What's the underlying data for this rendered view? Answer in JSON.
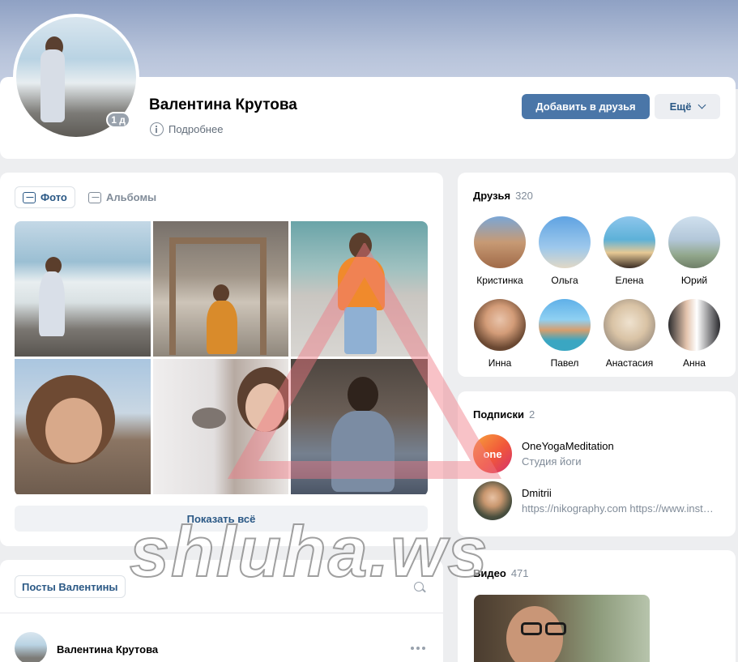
{
  "profile": {
    "name": "Валентина Крутова",
    "badge": "1 д",
    "more_info": "Подробнее",
    "add_friend": "Добавить в друзья",
    "more": "Ещё"
  },
  "photos": {
    "tabs": [
      {
        "label": "Фото"
      },
      {
        "label": "Альбомы"
      }
    ],
    "show_all": "Показать всё"
  },
  "posts": {
    "tab": "Посты Валентины",
    "first_post_author": "Валентина Крутова"
  },
  "friends": {
    "title": "Друзья",
    "count": "320",
    "items": [
      {
        "name": "Кристинка"
      },
      {
        "name": "Ольга"
      },
      {
        "name": "Елена"
      },
      {
        "name": "Юрий"
      },
      {
        "name": "Инна"
      },
      {
        "name": "Павел"
      },
      {
        "name": "Анастасия"
      },
      {
        "name": "Анна"
      }
    ]
  },
  "subscriptions": {
    "title": "Подписки",
    "count": "2",
    "items": [
      {
        "name": "OneYogaMeditation",
        "desc": "Студия йоги",
        "logo": "one"
      },
      {
        "name": "Dmitrii",
        "desc": "https://nikography.com https://www.instagram.com"
      }
    ]
  },
  "videos": {
    "title": "Видео",
    "count": "471"
  },
  "watermark": "shluha.ws",
  "colors": {
    "accent": "#4a76a8",
    "link": "#2a5885",
    "background": "#edeef0"
  }
}
